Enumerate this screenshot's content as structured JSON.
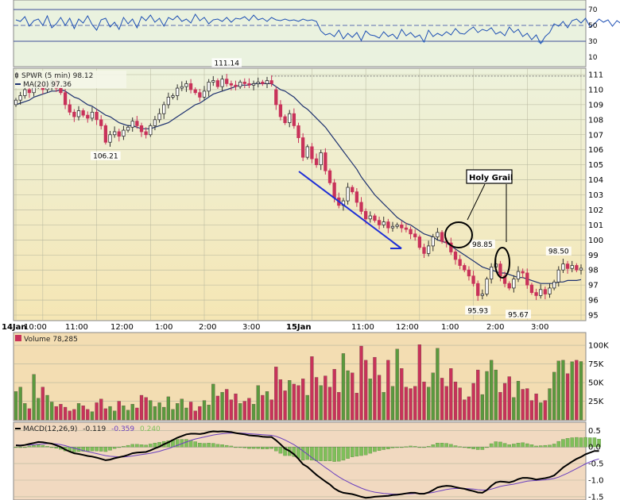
{
  "colors": {
    "up": "#5a9a3e",
    "down": "#c8325a",
    "price_bg_top": "#edf2dc",
    "price_bg_bottom": "#f5e6b4",
    "volume_bg": "#f3ddb2",
    "macd_bg": "#f1d9c0",
    "rsi_bg": "#eaf2df",
    "ma_line": "#1e3270",
    "rsi_line": "#1e50b4",
    "rsi_fill": "#5b8fd1",
    "macd_line": "#000000",
    "signal_line": "#6a3fbf",
    "hist": "#7fbf5a",
    "arrow": "#1f2fd6",
    "grid": "#b5b59c"
  },
  "chart_data": [
    {
      "type": "line",
      "panel": "rsi",
      "yticks": [
        "70",
        "50",
        "30",
        "10"
      ],
      "yrange": [
        0,
        80
      ],
      "reference_lines": [
        70,
        50,
        30
      ],
      "values": [
        57,
        55,
        61,
        49,
        56,
        58,
        50,
        62,
        47,
        52,
        60,
        50,
        59,
        46,
        58,
        53,
        62,
        51,
        44,
        57,
        59,
        48,
        54,
        45,
        60,
        52,
        58,
        47,
        61,
        56,
        63,
        54,
        59,
        49,
        60,
        57,
        62,
        55,
        58,
        53,
        64,
        56,
        60,
        52,
        57,
        58,
        55,
        60,
        54,
        59,
        58,
        61,
        56,
        63,
        57,
        59,
        55,
        60,
        57,
        56,
        58,
        56,
        57,
        55,
        58,
        56,
        57,
        55,
        43,
        38,
        40,
        36,
        44,
        33,
        40,
        35,
        41,
        31,
        43,
        38,
        37,
        34,
        42,
        36,
        39,
        33,
        45,
        37,
        41,
        35,
        38,
        29,
        44,
        36,
        40,
        37,
        42,
        38,
        46,
        40,
        39,
        44,
        48,
        41,
        45,
        43,
        47,
        39,
        42,
        37,
        48,
        41,
        45,
        36,
        40,
        32,
        38,
        27,
        36,
        41,
        52,
        49,
        55,
        47,
        56,
        58,
        53,
        59,
        48,
        52,
        58,
        54,
        57,
        49,
        56,
        52
      ]
    },
    {
      "type": "candlestick",
      "panel": "price",
      "title": "SPWR (5 min) 98.12",
      "ma_label": "MA(20) 97.36",
      "ylim": [
        95,
        111
      ],
      "yticks": [
        "111",
        "110",
        "109",
        "108",
        "107",
        "106",
        "105",
        "104",
        "103",
        "102",
        "101",
        "100",
        "99",
        "98",
        "97",
        "96",
        "95"
      ],
      "xticks": [
        "14Jan",
        "10:00",
        "11:00",
        "12:00",
        "1:00",
        "2:00",
        "3:00",
        "15Jan",
        "11:00",
        "12:00",
        "1:00",
        "2:00",
        "3:00"
      ],
      "bold_xticks": [
        "14Jan",
        "15Jan"
      ],
      "close": [
        109.3,
        109.6,
        110.0,
        109.8,
        110.2,
        110.4,
        110.0,
        110.3,
        110.6,
        110.1,
        109.8,
        109.0,
        108.5,
        108.2,
        108.6,
        108.3,
        108.1,
        108.5,
        108.0,
        107.6,
        106.5,
        107.0,
        107.2,
        106.9,
        107.3,
        107.5,
        107.9,
        107.6,
        107.2,
        107.0,
        107.6,
        108.0,
        108.4,
        109.0,
        109.5,
        109.6,
        110.1,
        110.2,
        110.4,
        110.0,
        109.8,
        109.5,
        109.9,
        110.5,
        110.6,
        110.2,
        110.7,
        110.4,
        110.3,
        110.2,
        110.5,
        110.4,
        110.3,
        110.4,
        110.5,
        110.4,
        110.6,
        110.4,
        109.0,
        108.2,
        107.8,
        108.4,
        107.6,
        106.8,
        105.5,
        106.2,
        105.4,
        105.0,
        105.8,
        104.6,
        103.8,
        102.8,
        102.3,
        102.6,
        103.5,
        103.2,
        102.5,
        101.9,
        101.4,
        101.6,
        101.3,
        101.0,
        101.2,
        100.8,
        100.9,
        101.0,
        100.8,
        100.7,
        100.4,
        100.2,
        99.5,
        99.1,
        99.6,
        100.2,
        100.5,
        99.9,
        99.8,
        99.2,
        98.7,
        98.3,
        98.0,
        97.6,
        97.1,
        96.3,
        96.4,
        97.4,
        98.2,
        98.4,
        97.6,
        97.1,
        96.8,
        97.4,
        97.9,
        97.8,
        97.0,
        96.5,
        96.3,
        96.7,
        96.4,
        96.8,
        97.2,
        98.0,
        98.4,
        98.1,
        98.3,
        98.0,
        98.12
      ],
      "ma20": [
        109.0,
        109.1,
        109.2,
        109.3,
        109.5,
        109.6,
        109.7,
        109.8,
        109.9,
        109.9,
        110.0,
        109.9,
        109.7,
        109.5,
        109.4,
        109.2,
        109.0,
        108.9,
        108.7,
        108.5,
        108.3,
        108.2,
        108.0,
        107.8,
        107.7,
        107.6,
        107.6,
        107.5,
        107.4,
        107.4,
        107.4,
        107.5,
        107.6,
        107.7,
        107.8,
        108.0,
        108.2,
        108.4,
        108.6,
        108.8,
        109.0,
        109.1,
        109.3,
        109.5,
        109.7,
        109.8,
        109.9,
        110.0,
        110.1,
        110.2,
        110.3,
        110.3,
        110.3,
        110.4,
        110.4,
        110.4,
        110.4,
        110.4,
        110.2,
        110.0,
        109.9,
        109.7,
        109.5,
        109.2,
        108.9,
        108.7,
        108.4,
        108.1,
        107.8,
        107.5,
        107.1,
        106.7,
        106.3,
        105.9,
        105.5,
        105.1,
        104.7,
        104.2,
        103.8,
        103.4,
        103.0,
        102.7,
        102.4,
        102.1,
        101.8,
        101.5,
        101.3,
        101.1,
        101.0,
        100.8,
        100.6,
        100.4,
        100.3,
        100.2,
        100.0,
        99.9,
        99.8,
        99.6,
        99.4,
        99.2,
        99.0,
        98.8,
        98.6,
        98.4,
        98.2,
        98.1,
        98.0,
        97.9,
        97.8,
        97.8,
        97.7,
        97.6,
        97.5,
        97.5,
        97.4,
        97.3,
        97.2,
        97.1,
        97.1,
        97.1,
        97.1,
        97.2,
        97.2,
        97.3,
        97.3,
        97.3,
        97.36
      ],
      "prev_close_line": 110.9,
      "annotations": [
        {
          "text": "111.14",
          "value": 111.14
        },
        {
          "text": "106.21",
          "value": 106.21
        },
        {
          "text": "98.85",
          "value": 98.85
        },
        {
          "text": "95.93",
          "value": 95.93
        },
        {
          "text": "95.67",
          "value": 95.67
        },
        {
          "text": "98.50",
          "value": 98.5
        },
        {
          "text": "Holy Grail",
          "kind": "callout"
        }
      ]
    },
    {
      "type": "bar",
      "panel": "volume",
      "title": "Volume 78,285",
      "ylim": [
        0,
        115000
      ],
      "yticks": [
        "100K",
        "75K",
        "50K",
        "25K"
      ],
      "values": [
        38000,
        44000,
        22000,
        15000,
        61000,
        29000,
        44000,
        33000,
        24000,
        18000,
        21000,
        17000,
        12000,
        14000,
        22000,
        19000,
        14000,
        11000,
        23000,
        28000,
        15000,
        18000,
        12000,
        25000,
        19000,
        13000,
        21000,
        16000,
        33000,
        30000,
        26000,
        18000,
        23000,
        17000,
        31000,
        14000,
        22000,
        28000,
        16000,
        24000,
        12000,
        18000,
        26000,
        20000,
        48000,
        32000,
        37000,
        41000,
        27000,
        35000,
        22000,
        25000,
        29000,
        21000,
        46000,
        33000,
        38000,
        27000,
        71000,
        54000,
        39000,
        53000,
        48000,
        46000,
        55000,
        33000,
        85000,
        57000,
        46000,
        59000,
        44000,
        68000,
        37000,
        89000,
        66000,
        63000,
        36000,
        99000,
        80000,
        55000,
        84000,
        60000,
        37000,
        80000,
        45000,
        95000,
        69000,
        44000,
        42000,
        45000,
        101000,
        51000,
        44000,
        63000,
        96000,
        56000,
        45000,
        69000,
        51000,
        43000,
        27000,
        31000,
        49000,
        67000,
        34000,
        65000,
        80000,
        67000,
        37000,
        49000,
        58000,
        30000,
        52000,
        41000,
        42000,
        26000,
        35000,
        23000,
        26000,
        42000,
        64000,
        79000,
        80000,
        62000,
        78000,
        80000,
        78285
      ],
      "series_colors": "up/down follow candle direction"
    },
    {
      "type": "line",
      "panel": "macd",
      "title": "MACD(12,26,9)",
      "macd_value": "-0.119",
      "signal_value": "-0.359",
      "hist_value": "0.240",
      "ylim": [
        -1.55,
        0.65
      ],
      "yticks": [
        "0.5",
        "0.0",
        "-0.5",
        "-1.0",
        "-1.5"
      ],
      "macd": [
        0.05,
        0.04,
        0.06,
        0.09,
        0.12,
        0.15,
        0.14,
        0.12,
        0.1,
        0.05,
        0.0,
        -0.08,
        -0.14,
        -0.19,
        -0.21,
        -0.24,
        -0.27,
        -0.29,
        -0.32,
        -0.36,
        -0.4,
        -0.38,
        -0.34,
        -0.31,
        -0.28,
        -0.24,
        -0.19,
        -0.17,
        -0.16,
        -0.15,
        -0.1,
        -0.04,
        0.01,
        0.08,
        0.14,
        0.21,
        0.28,
        0.33,
        0.38,
        0.4,
        0.4,
        0.39,
        0.41,
        0.45,
        0.47,
        0.46,
        0.47,
        0.46,
        0.45,
        0.42,
        0.4,
        0.38,
        0.35,
        0.34,
        0.33,
        0.31,
        0.3,
        0.3,
        0.2,
        0.08,
        -0.05,
        -0.12,
        -0.22,
        -0.36,
        -0.52,
        -0.6,
        -0.72,
        -0.84,
        -0.94,
        -1.04,
        -1.13,
        -1.25,
        -1.33,
        -1.38,
        -1.4,
        -1.42,
        -1.46,
        -1.5,
        -1.53,
        -1.52,
        -1.5,
        -1.49,
        -1.48,
        -1.47,
        -1.45,
        -1.44,
        -1.42,
        -1.4,
        -1.38,
        -1.38,
        -1.41,
        -1.41,
        -1.37,
        -1.3,
        -1.22,
        -1.19,
        -1.17,
        -1.18,
        -1.21,
        -1.24,
        -1.26,
        -1.3,
        -1.33,
        -1.37,
        -1.38,
        -1.3,
        -1.17,
        -1.07,
        -1.04,
        -1.05,
        -1.07,
        -1.03,
        -0.97,
        -0.93,
        -0.93,
        -0.95,
        -0.98,
        -0.96,
        -0.94,
        -0.91,
        -0.86,
        -0.74,
        -0.62,
        -0.53,
        -0.44,
        -0.36,
        -0.3,
        -0.22,
        -0.17,
        -0.12,
        -0.119
      ],
      "signal": [
        0.06,
        0.06,
        0.06,
        0.06,
        0.07,
        0.08,
        0.09,
        0.1,
        0.1,
        0.09,
        0.07,
        0.04,
        0.0,
        -0.04,
        -0.07,
        -0.11,
        -0.14,
        -0.17,
        -0.2,
        -0.23,
        -0.26,
        -0.28,
        -0.29,
        -0.3,
        -0.3,
        -0.29,
        -0.27,
        -0.25,
        -0.23,
        -0.21,
        -0.19,
        -0.16,
        -0.13,
        -0.09,
        -0.05,
        0.0,
        0.05,
        0.1,
        0.15,
        0.2,
        0.24,
        0.27,
        0.3,
        0.33,
        0.36,
        0.38,
        0.4,
        0.41,
        0.42,
        0.42,
        0.42,
        0.41,
        0.4,
        0.39,
        0.38,
        0.37,
        0.36,
        0.35,
        0.32,
        0.27,
        0.21,
        0.14,
        0.07,
        -0.02,
        -0.12,
        -0.22,
        -0.32,
        -0.42,
        -0.52,
        -0.62,
        -0.71,
        -0.81,
        -0.9,
        -0.98,
        -1.05,
        -1.12,
        -1.18,
        -1.24,
        -1.29,
        -1.33,
        -1.36,
        -1.38,
        -1.4,
        -1.41,
        -1.42,
        -1.42,
        -1.42,
        -1.41,
        -1.41,
        -1.4,
        -1.4,
        -1.4,
        -1.39,
        -1.37,
        -1.34,
        -1.31,
        -1.28,
        -1.26,
        -1.25,
        -1.25,
        -1.25,
        -1.26,
        -1.27,
        -1.29,
        -1.3,
        -1.3,
        -1.27,
        -1.23,
        -1.19,
        -1.16,
        -1.14,
        -1.12,
        -1.09,
        -1.06,
        -1.03,
        -1.02,
        -1.01,
        -1.0,
        -0.99,
        -0.97,
        -0.95,
        -0.91,
        -0.85,
        -0.79,
        -0.72,
        -0.65,
        -0.58,
        -0.51,
        -0.45,
        -0.4,
        -0.359
      ]
    }
  ]
}
